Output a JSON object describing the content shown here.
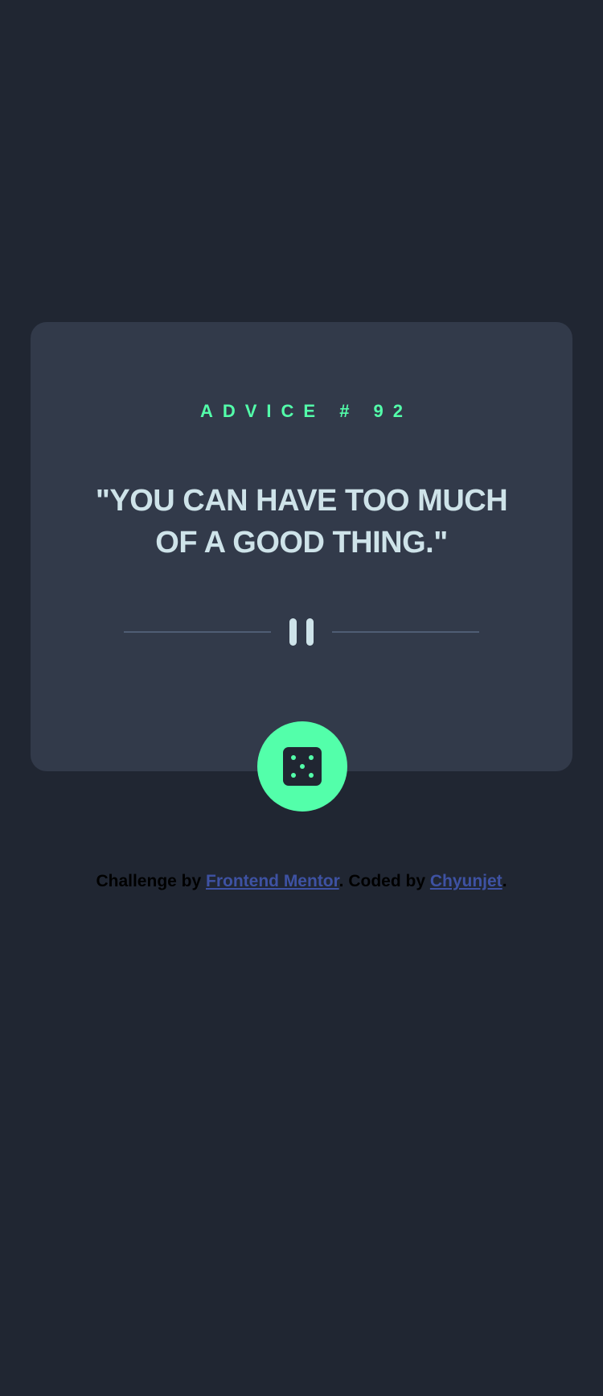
{
  "advice": {
    "label": "ADVICE # 92",
    "text": "\"YOU CAN HAVE TOO MUCH OF A GOOD THING.\""
  },
  "icons": {
    "divider": "pause-divider-icon",
    "dice": "dice-icon"
  },
  "footer": {
    "prefix": "Challenge by ",
    "mentor_link": "Frontend Mentor",
    "middle": ". Coded by ",
    "author_link": "Chyunjet",
    "suffix": "."
  },
  "colors": {
    "background": "#202632",
    "card": "#323a4a",
    "accent": "#53ffaa",
    "text": "#cee3e9",
    "divider": "#4f5d74",
    "link": "#3e52a3"
  }
}
